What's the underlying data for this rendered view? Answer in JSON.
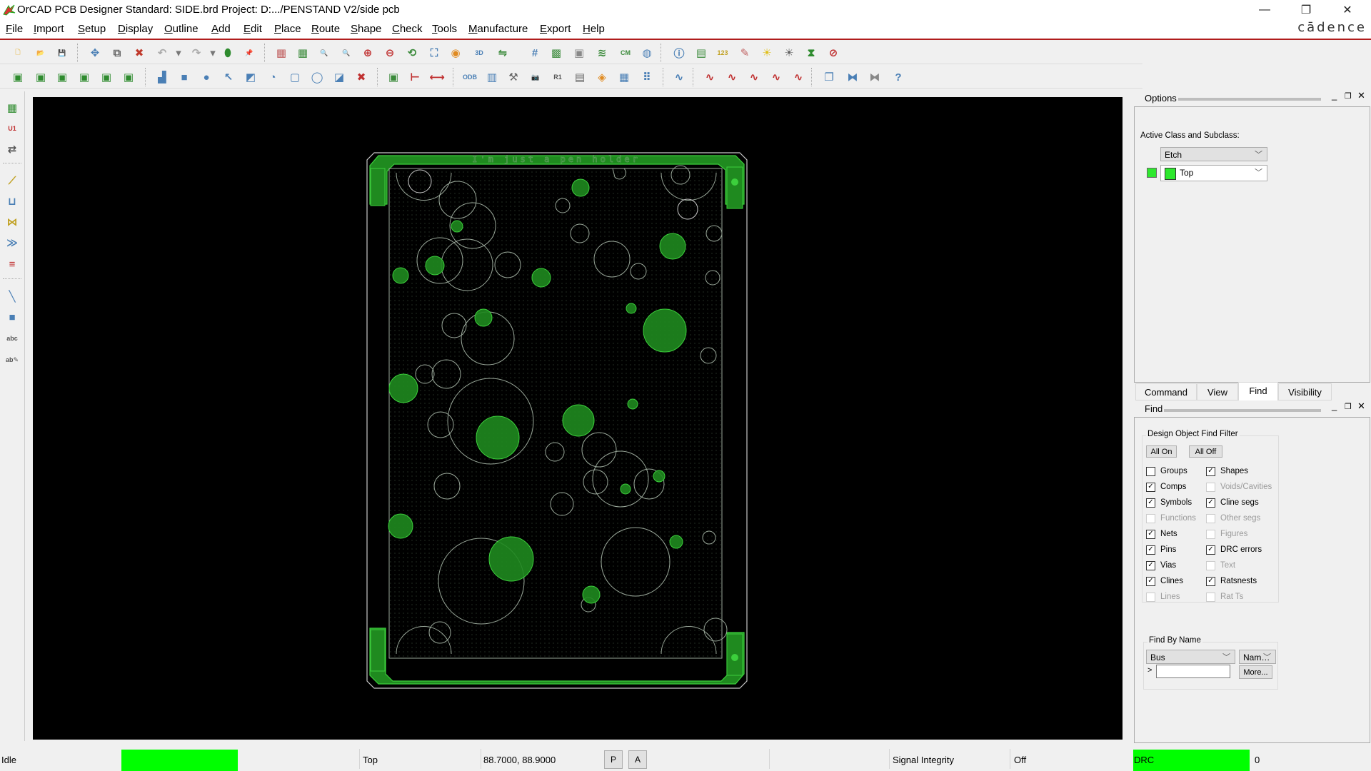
{
  "window": {
    "title": "OrCAD PCB Designer Standard: SIDE.brd  Project: D:.../PENSTAND V2/side pcb",
    "brand": "cādence",
    "controls": {
      "minimize": "—",
      "restore": "❐",
      "close": "✕"
    }
  },
  "menu": [
    "File",
    "Import",
    "Setup",
    "Display",
    "Outline",
    "Add",
    "Edit",
    "Place",
    "Route",
    "Shape",
    "Check",
    "Tools",
    "Manufacture",
    "Export",
    "Help"
  ],
  "toolbar_row1": [
    {
      "icon": "new-file-icon",
      "glyph": "🗋",
      "color": "#e9c46a"
    },
    {
      "icon": "open-folder-icon",
      "glyph": "📂",
      "color": "#e9c46a"
    },
    {
      "icon": "save-icon",
      "glyph": "💾",
      "color": "#999"
    },
    {
      "icon": "move-icon",
      "glyph": "✥",
      "color": "#4a7fb5"
    },
    {
      "icon": "copy-icon",
      "glyph": "⧉",
      "color": "#666"
    },
    {
      "icon": "delete-icon",
      "glyph": "✖",
      "color": "#c0392b"
    },
    {
      "icon": "undo-icon",
      "glyph": "↶",
      "color": "#aaa"
    },
    {
      "icon": "undo-dropdown-icon",
      "glyph": "▾",
      "color": "#777"
    },
    {
      "icon": "redo-icon",
      "glyph": "↷",
      "color": "#aaa"
    },
    {
      "icon": "redo-dropdown-icon",
      "glyph": "▾",
      "color": "#777"
    },
    {
      "icon": "shape-select-icon",
      "glyph": "⬮",
      "color": "#2e8b2e"
    },
    {
      "icon": "pin-icon",
      "glyph": "📌",
      "color": "#2e8b2e"
    },
    {
      "icon": "unrats-icon",
      "glyph": "▦",
      "color": "#c06060"
    },
    {
      "icon": "rats-icon",
      "glyph": "▦",
      "color": "#3a8a3a"
    },
    {
      "icon": "zoom-points-icon",
      "glyph": "🔍",
      "color": "#4a7fb5"
    },
    {
      "icon": "zoom-fit-icon",
      "glyph": "🔍",
      "color": "#b05080"
    },
    {
      "icon": "zoom-in-icon",
      "glyph": "⊕",
      "color": "#c03030"
    },
    {
      "icon": "zoom-out-icon",
      "glyph": "⊖",
      "color": "#c03030"
    },
    {
      "icon": "zoom-previous-icon",
      "glyph": "⟲",
      "color": "#3a8a3a"
    },
    {
      "icon": "zoom-world-icon",
      "glyph": "⛶",
      "color": "#4a7fb5"
    },
    {
      "icon": "redraw-icon",
      "glyph": "◉",
      "color": "#e08a20"
    },
    {
      "icon": "3d-view-icon",
      "glyph": "3D",
      "color": "#4a7fb5"
    },
    {
      "icon": "flip-design-icon",
      "glyph": "⇋",
      "color": "#3a8a3a"
    },
    {
      "icon": "grid-toggle-icon",
      "glyph": "#",
      "color": "#4a7fb5"
    },
    {
      "icon": "color-dialog-icon",
      "glyph": "▩",
      "color": "#3a8a3a"
    },
    {
      "icon": "shadow-mode-icon",
      "glyph": "▣",
      "color": "#888"
    },
    {
      "icon": "layer-visibility-icon",
      "glyph": "≋",
      "color": "#3a8a3a"
    },
    {
      "icon": "constraint-manager-icon",
      "glyph": "CM",
      "color": "#3a8a3a"
    },
    {
      "icon": "global-dynamic-icon",
      "glyph": "◍",
      "color": "#4a7fb5"
    },
    {
      "icon": "show-element-icon",
      "glyph": "ⓘ",
      "color": "#4a7fb5"
    },
    {
      "icon": "property-edit-icon",
      "glyph": "▤",
      "color": "#3a8a3a"
    },
    {
      "icon": "measure-icon",
      "glyph": "123",
      "color": "#c0a020"
    },
    {
      "icon": "highlight-icon",
      "glyph": "✎",
      "color": "#c06060"
    },
    {
      "icon": "assign-color-icon",
      "glyph": "☀",
      "color": "#e0c020"
    },
    {
      "icon": "dehighlight-icon",
      "glyph": "☀",
      "color": "#666"
    },
    {
      "icon": "waive-drc-icon",
      "glyph": "⧗",
      "color": "#2e8b2e"
    },
    {
      "icon": "drc-toggle-icon",
      "glyph": "⊘",
      "color": "#c03030"
    }
  ],
  "toolbar_row2": [
    {
      "icon": "app-mode-general-icon",
      "glyph": "▣",
      "color": "#2e8b2e"
    },
    {
      "icon": "app-mode-placement-icon",
      "glyph": "▣",
      "color": "#2e8b2e"
    },
    {
      "icon": "app-mode-etch-edit-icon",
      "glyph": "▣",
      "color": "#2e8b2e"
    },
    {
      "icon": "app-mode-flow-planning-icon",
      "glyph": "▣",
      "color": "#2e8b2e"
    },
    {
      "icon": "app-mode-shape-edit-icon",
      "glyph": "▣",
      "color": "#2e8b2e"
    },
    {
      "icon": "app-mode-signal-integrity-icon",
      "glyph": "▣",
      "color": "#2e8b2e"
    },
    {
      "icon": "shape-polygon-icon",
      "glyph": "▟",
      "color": "#4a7fb5"
    },
    {
      "icon": "shape-rectangle-icon",
      "glyph": "■",
      "color": "#4a7fb5"
    },
    {
      "icon": "shape-circle-icon",
      "glyph": "●",
      "color": "#4a7fb5"
    },
    {
      "icon": "shape-select-icon",
      "glyph": "↖",
      "color": "#4a7fb5"
    },
    {
      "icon": "manual-void-icon",
      "glyph": "◩",
      "color": "#4a7fb5"
    },
    {
      "icon": "void-circle-icon",
      "glyph": "◔",
      "color": "#4a7fb5"
    },
    {
      "icon": "void-rectangle-icon",
      "glyph": "▢",
      "color": "#4a7fb5"
    },
    {
      "icon": "void-polygon-icon",
      "glyph": "◯",
      "color": "#4a7fb5"
    },
    {
      "icon": "edit-boundary-icon",
      "glyph": "◪",
      "color": "#4a7fb5"
    },
    {
      "icon": "delete-islands-icon",
      "glyph": "✖",
      "color": "#c03030"
    },
    {
      "icon": "dimension-environment-icon",
      "glyph": "▣",
      "color": "#3a8a3a"
    },
    {
      "icon": "linear-dimension-icon",
      "glyph": "⊢",
      "color": "#c03030"
    },
    {
      "icon": "datum-dimension-icon",
      "glyph": "⟷",
      "color": "#c03030"
    },
    {
      "icon": "odb-export-icon",
      "glyph": "ODB",
      "color": "#4a7fb5"
    },
    {
      "icon": "artwork-icon",
      "glyph": "▥",
      "color": "#4a7fb5"
    },
    {
      "icon": "ncdrill-icon",
      "glyph": "⚒",
      "color": "#666"
    },
    {
      "icon": "snapshot-icon",
      "glyph": "📷",
      "color": "#666"
    },
    {
      "icon": "rename-refdes-icon",
      "glyph": "R1",
      "color": "#555"
    },
    {
      "icon": "silkscreen-icon",
      "glyph": "▤",
      "color": "#666"
    },
    {
      "icon": "testprep-icon",
      "glyph": "◈",
      "color": "#e08a20"
    },
    {
      "icon": "grid-array-icon",
      "glyph": "▦",
      "color": "#4a7fb5"
    },
    {
      "icon": "dot-array-icon",
      "glyph": "⠿",
      "color": "#4a7fb5"
    },
    {
      "icon": "slide-icon",
      "glyph": "∿",
      "color": "#4a7fb5"
    },
    {
      "icon": "sigxp-icon",
      "glyph": "∿",
      "color": "#c03030"
    },
    {
      "icon": "si-library-icon",
      "glyph": "∿",
      "color": "#c03030"
    },
    {
      "icon": "si-model-icon",
      "glyph": "∿",
      "color": "#c03030"
    },
    {
      "icon": "si-audit-icon",
      "glyph": "∿",
      "color": "#c03030"
    },
    {
      "icon": "si-probe-icon",
      "glyph": "∿",
      "color": "#c03030"
    },
    {
      "icon": "cascade-windows-icon",
      "glyph": "❐",
      "color": "#4a7fb5"
    },
    {
      "icon": "tile-windows-icon",
      "glyph": "⧓",
      "color": "#4a7fb5"
    },
    {
      "icon": "window-icon",
      "glyph": "⧓",
      "color": "#888"
    },
    {
      "icon": "help-icon",
      "glyph": "?",
      "color": "#4a7fb5"
    }
  ],
  "left_tools": [
    {
      "icon": "place-manual-icon",
      "glyph": "▦",
      "color": "#2e8b2e"
    },
    {
      "icon": "component-u1-icon",
      "glyph": "U1",
      "color": "#c03030"
    },
    {
      "icon": "swap-components-icon",
      "glyph": "⇄",
      "color": "#555"
    },
    {
      "icon": "add-connect-icon",
      "glyph": "⟋",
      "color": "#c0a020"
    },
    {
      "icon": "slide-etch-icon",
      "glyph": "⊔",
      "color": "#4a7fb5"
    },
    {
      "icon": "delay-tune-icon",
      "glyph": "⋈",
      "color": "#c0a020"
    },
    {
      "icon": "custom-smooth-icon",
      "glyph": "≫",
      "color": "#4a7fb5"
    },
    {
      "icon": "vertex-icon",
      "glyph": "≡",
      "color": "#c03030"
    },
    {
      "icon": "add-line-icon",
      "glyph": "╲",
      "color": "#4a7fb5"
    },
    {
      "icon": "add-rect-icon",
      "glyph": "■",
      "color": "#4a7fb5"
    },
    {
      "icon": "add-text-icon",
      "glyph": "abc",
      "color": "#555"
    },
    {
      "icon": "edit-text-icon",
      "glyph": "ab✎",
      "color": "#555"
    }
  ],
  "board": {
    "silkscreen_text": "I'm just a pen holder",
    "colors": {
      "etch": "#1f8a1f",
      "etch_edge": "#3ccf3c",
      "outline": "#c8c8c8",
      "drawing": "#9aa89a"
    }
  },
  "options_panel": {
    "title": "Options",
    "active_class_label": "Active Class and Subclass:",
    "class_value": "Etch",
    "subclass_value": "Top",
    "subclass_color": "#2ee82e"
  },
  "tabs": [
    {
      "label": "Command",
      "active": false
    },
    {
      "label": "View",
      "active": false
    },
    {
      "label": "Find",
      "active": true
    },
    {
      "label": "Visibility",
      "active": false
    }
  ],
  "find_panel": {
    "title": "Find",
    "filter_group_label": "Design Object Find Filter",
    "all_on_label": "All On",
    "all_off_label": "All Off",
    "left_column": [
      {
        "label": "Groups",
        "checked": false,
        "enabled": true
      },
      {
        "label": "Comps",
        "checked": true,
        "enabled": true
      },
      {
        "label": "Symbols",
        "checked": true,
        "enabled": true
      },
      {
        "label": "Functions",
        "checked": false,
        "enabled": false
      },
      {
        "label": "Nets",
        "checked": true,
        "enabled": true
      },
      {
        "label": "Pins",
        "checked": true,
        "enabled": true
      },
      {
        "label": "Vias",
        "checked": true,
        "enabled": true
      },
      {
        "label": "Clines",
        "checked": true,
        "enabled": true
      },
      {
        "label": "Lines",
        "checked": false,
        "enabled": false
      }
    ],
    "right_column": [
      {
        "label": "Shapes",
        "checked": true,
        "enabled": true
      },
      {
        "label": "Voids/Cavities",
        "checked": false,
        "enabled": false
      },
      {
        "label": "Cline segs",
        "checked": true,
        "enabled": true
      },
      {
        "label": "Other segs",
        "checked": false,
        "enabled": false
      },
      {
        "label": "Figures",
        "checked": false,
        "enabled": false
      },
      {
        "label": "DRC errors",
        "checked": true,
        "enabled": true
      },
      {
        "label": "Text",
        "checked": false,
        "enabled": false
      },
      {
        "label": "Ratsnests",
        "checked": true,
        "enabled": true
      },
      {
        "label": "Rat Ts",
        "checked": false,
        "enabled": false
      }
    ],
    "find_by_name_label": "Find By Name",
    "type_value": "Bus",
    "mode_value": "Nam…",
    "prompt": ">",
    "name_input_value": "",
    "more_label": "More..."
  },
  "status_bar": {
    "state": "Idle",
    "state_indicator_color": "#00ff00",
    "layer": "Top",
    "coordinates": "88.7000, 88.9000",
    "p_label": "P",
    "a_label": "A",
    "signal_integrity_label": "Signal Integrity",
    "signal_integrity_value": "Off",
    "drc_label": "DRC",
    "drc_indicator_color": "#00ff00",
    "drc_count": "0"
  }
}
